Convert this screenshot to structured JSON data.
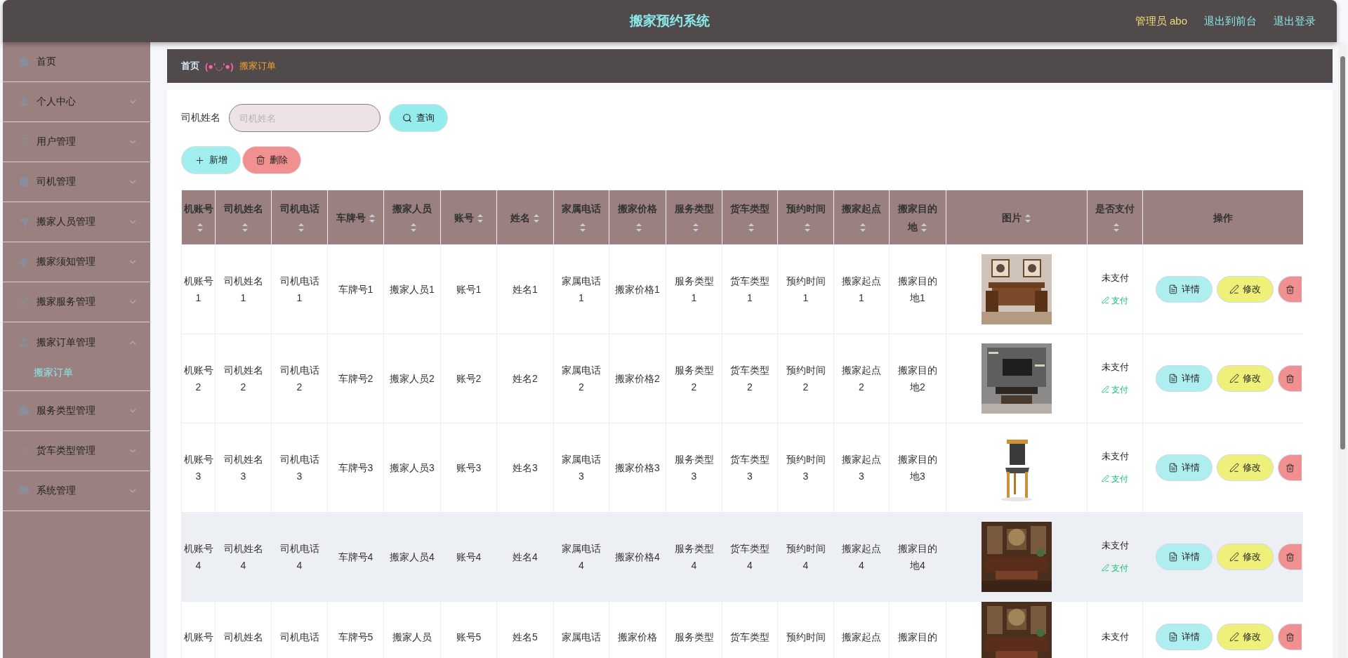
{
  "header": {
    "title": "搬家预约系统",
    "user": "管理员 abo",
    "links": [
      "退出到前台",
      "退出登录"
    ]
  },
  "sidebar": {
    "items": [
      {
        "kind": "link",
        "label": "首页"
      },
      {
        "kind": "group",
        "label": "个人中心",
        "expanded": false
      },
      {
        "kind": "group",
        "label": "用户管理",
        "expanded": false
      },
      {
        "kind": "group",
        "label": "司机管理",
        "expanded": false
      },
      {
        "kind": "group",
        "label": "搬家人员管理",
        "expanded": false
      },
      {
        "kind": "group",
        "label": "搬家须知管理",
        "expanded": false
      },
      {
        "kind": "group",
        "label": "搬家服务管理",
        "expanded": false
      },
      {
        "kind": "group",
        "label": "搬家订单管理",
        "expanded": true,
        "children": [
          {
            "label": "搬家订单",
            "selected": true
          }
        ]
      },
      {
        "kind": "group",
        "label": "服务类型管理",
        "expanded": false
      },
      {
        "kind": "group",
        "label": "货车类型管理",
        "expanded": false
      },
      {
        "kind": "group",
        "label": "系统管理",
        "expanded": false
      }
    ]
  },
  "breadcrumb": {
    "home": "首页",
    "separator": "(●'◡'●)",
    "current": "搬家订单"
  },
  "search": {
    "label": "司机姓名",
    "placeholder": "司机姓名",
    "button": "查询"
  },
  "actions": [
    {
      "kind": "add",
      "label": "新增"
    },
    {
      "kind": "delete",
      "label": "删除"
    }
  ],
  "table": {
    "columns": [
      {
        "label": "机账号",
        "sortable": true
      },
      {
        "label": "司机姓名",
        "sortable": true
      },
      {
        "label": "司机电话",
        "sortable": true
      },
      {
        "label": "车牌号",
        "sortable": true
      },
      {
        "label": "搬家人员",
        "sortable": true
      },
      {
        "label": "账号",
        "sortable": true
      },
      {
        "label": "姓名",
        "sortable": true
      },
      {
        "label": "家属电话",
        "sortable": true
      },
      {
        "label": "搬家价格",
        "sortable": true
      },
      {
        "label": "服务类型",
        "sortable": true
      },
      {
        "label": "货车类型",
        "sortable": true
      },
      {
        "label": "预约时间",
        "sortable": true
      },
      {
        "label": "搬家起点",
        "sortable": true
      },
      {
        "label": "搬家目的地",
        "sortable": true
      },
      {
        "label": "图片",
        "sortable": true
      },
      {
        "label": "是否支付",
        "sortable": true
      },
      {
        "label": "操作",
        "sortable": false
      }
    ],
    "rows": [
      {
        "highlighted": false,
        "cells": [
          "机账号1",
          "司机姓名1",
          "司机电话1",
          "车牌号1",
          "搬家人员1",
          "账号1",
          "姓名1",
          "家属电话1",
          "搬家价格1",
          "服务类型1",
          "货车类型1",
          "预约时间1",
          "搬家起点1",
          "搬家目的地1"
        ],
        "pay_status": "未支付",
        "pay_link": "支付",
        "buttons": [
          {
            "kind": "detail",
            "label": "详情"
          },
          {
            "kind": "edit",
            "label": "修改"
          },
          {
            "kind": "delete"
          }
        ]
      },
      {
        "highlighted": false,
        "cells": [
          "机账号2",
          "司机姓名2",
          "司机电话2",
          "车牌号2",
          "搬家人员2",
          "账号2",
          "姓名2",
          "家属电话2",
          "搬家价格2",
          "服务类型2",
          "货车类型2",
          "预约时间2",
          "搬家起点2",
          "搬家目的地2"
        ],
        "pay_status": "未支付",
        "pay_link": "支付",
        "buttons": [
          {
            "kind": "detail",
            "label": "详情"
          },
          {
            "kind": "edit",
            "label": "修改"
          },
          {
            "kind": "delete"
          }
        ]
      },
      {
        "highlighted": false,
        "cells": [
          "机账号3",
          "司机姓名3",
          "司机电话3",
          "车牌号3",
          "搬家人员3",
          "账号3",
          "姓名3",
          "家属电话3",
          "搬家价格3",
          "服务类型3",
          "货车类型3",
          "预约时间3",
          "搬家起点3",
          "搬家目的地3"
        ],
        "pay_status": "未支付",
        "pay_link": "支付",
        "buttons": [
          {
            "kind": "detail",
            "label": "详情"
          },
          {
            "kind": "edit",
            "label": "修改"
          },
          {
            "kind": "delete"
          }
        ]
      },
      {
        "highlighted": true,
        "cells": [
          "机账号4",
          "司机姓名4",
          "司机电话4",
          "车牌号4",
          "搬家人员4",
          "账号4",
          "姓名4",
          "家属电话4",
          "搬家价格4",
          "服务类型4",
          "货车类型4",
          "预约时间4",
          "搬家起点4",
          "搬家目的地4"
        ],
        "pay_status": "未支付",
        "pay_link": "支付",
        "buttons": [
          {
            "kind": "detail",
            "label": "详情"
          },
          {
            "kind": "edit",
            "label": "修改"
          },
          {
            "kind": "delete"
          }
        ]
      },
      {
        "highlighted": false,
        "cells": [
          "机账号",
          "司机姓名",
          "司机电话",
          "车牌号5",
          "搬家人员",
          "账号5",
          "姓名5",
          "家属电话",
          "搬家价格",
          "服务类型",
          "货车类型",
          "预约时间",
          "搬家起点",
          "搬家目的"
        ],
        "pay_status": "未支付",
        "buttons": [
          {
            "kind": "detail",
            "label": "详情"
          },
          {
            "kind": "edit",
            "label": "修改"
          },
          {
            "kind": "delete"
          }
        ]
      }
    ]
  }
}
